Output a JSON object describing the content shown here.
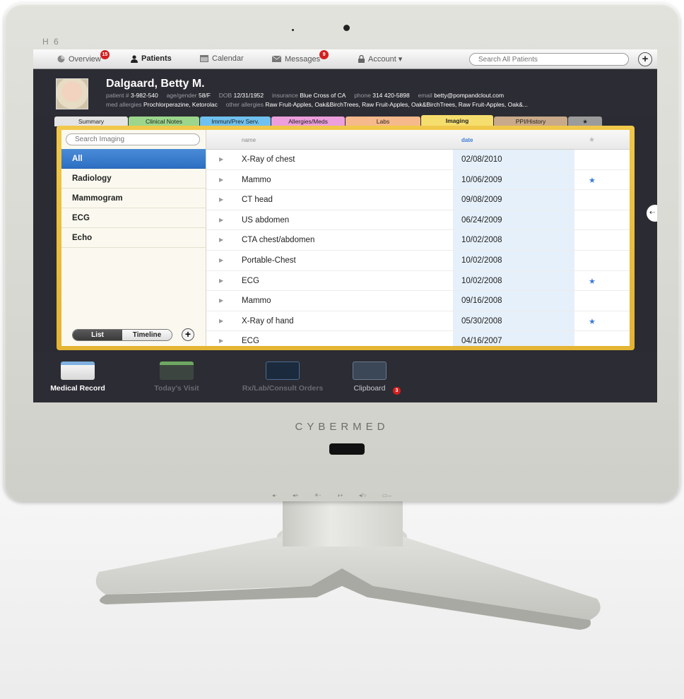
{
  "device": {
    "model": "H 6",
    "brand": "CYBERMED",
    "hw_buttons": [
      "◂-",
      "◂+",
      "☀-",
      "◑+",
      "◂/○",
      "▭←"
    ]
  },
  "nav": {
    "items": [
      {
        "label": "Overview",
        "icon": "pie-chart-icon",
        "badge": "15"
      },
      {
        "label": "Patients",
        "icon": "person-icon",
        "active": true
      },
      {
        "label": "Calendar",
        "icon": "calendar-icon"
      },
      {
        "label": "Messages",
        "icon": "envelope-icon",
        "badge": "9"
      },
      {
        "label": "Account ▾",
        "icon": "lock-icon"
      }
    ],
    "search_placeholder": "Search All Patients",
    "add_label": "+"
  },
  "patient": {
    "name": "Dalgaard, Betty M.",
    "patient_no_label": "patient #",
    "patient_no": "3-982-540",
    "age_gender_label": "age/gender",
    "age_gender": "58/F",
    "dob_label": "DOB",
    "dob": "12/31/1952",
    "insurance_label": "insurance",
    "insurance": "Blue Cross of CA",
    "phone_label": "phone",
    "phone": "314 420-5898",
    "email_label": "email",
    "email": "betty@pompandclout.com",
    "med_allergies_label": "med allergies",
    "med_allergies": "Prochlorperazine, Ketorolac",
    "other_allergies_label": "other allergies",
    "other_allergies": "Raw Fruit-Apples, Oak&BirchTrees, Raw Fruit-Apples, Oak&BirchTrees, Raw Fruit-Apples, Oak&..."
  },
  "tabs": [
    {
      "label": "Summary",
      "color": "#e4e4e4"
    },
    {
      "label": "Clinical Notes",
      "color": "#9bd68c"
    },
    {
      "label": "Immun/Prev Serv.",
      "color": "#6fc1ef"
    },
    {
      "label": "Allergies/Meds",
      "color": "#ec9fdc"
    },
    {
      "label": "Labs",
      "color": "#f6b98c"
    },
    {
      "label": "Imaging",
      "color": "#f6de6e",
      "active": true
    },
    {
      "label": "PPI/History",
      "color": "#c8a98a"
    },
    {
      "label": "★",
      "color": "#9b9b9b"
    }
  ],
  "sidebar": {
    "search_placeholder": "Search Imaging",
    "categories": [
      {
        "label": "All",
        "active": true
      },
      {
        "label": "Radiology"
      },
      {
        "label": "Mammogram"
      },
      {
        "label": "ECG"
      },
      {
        "label": "Echo"
      }
    ],
    "view_toggle": [
      "List",
      "Timeline"
    ],
    "view_selected": "List",
    "add_label": "+"
  },
  "list": {
    "columns": {
      "name": "name",
      "date": "date",
      "star": "★"
    },
    "rows": [
      {
        "name": "X-Ray of chest",
        "date": "02/08/2010",
        "starred": ""
      },
      {
        "name": "Mammo",
        "date": "10/06/2009",
        "starred": "★"
      },
      {
        "name": "CT head",
        "date": "09/08/2009",
        "starred": ""
      },
      {
        "name": "US abdomen",
        "date": "06/24/2009",
        "starred": ""
      },
      {
        "name": "CTA chest/abdomen",
        "date": "10/02/2008",
        "starred": ""
      },
      {
        "name": "Portable-Chest",
        "date": "10/02/2008",
        "starred": ""
      },
      {
        "name": "ECG",
        "date": "10/02/2008",
        "starred": "★"
      },
      {
        "name": "Mammo",
        "date": "09/16/2008",
        "starred": ""
      },
      {
        "name": "X-Ray of hand",
        "date": "05/30/2008",
        "starred": "★"
      },
      {
        "name": "ECG",
        "date": "04/16/2007",
        "starred": ""
      }
    ],
    "expand_glyph": "▶"
  },
  "side_handle": "⇠",
  "dock": [
    {
      "label": "Medical Record",
      "active": true,
      "icon": "medical-record-icon"
    },
    {
      "label": "Today's Visit",
      "icon": "todays-visit-icon"
    },
    {
      "label": "Rx/Lab/Consult Orders",
      "icon": "orders-icon"
    },
    {
      "label": "Clipboard",
      "icon": "clipboard-icon",
      "badge": "3"
    }
  ],
  "colors": {
    "accent_blue": "#3a7bd5",
    "panel_gold": "#e8ba3a",
    "badge_red": "#d42020",
    "dark_bg": "#2c2c34"
  }
}
